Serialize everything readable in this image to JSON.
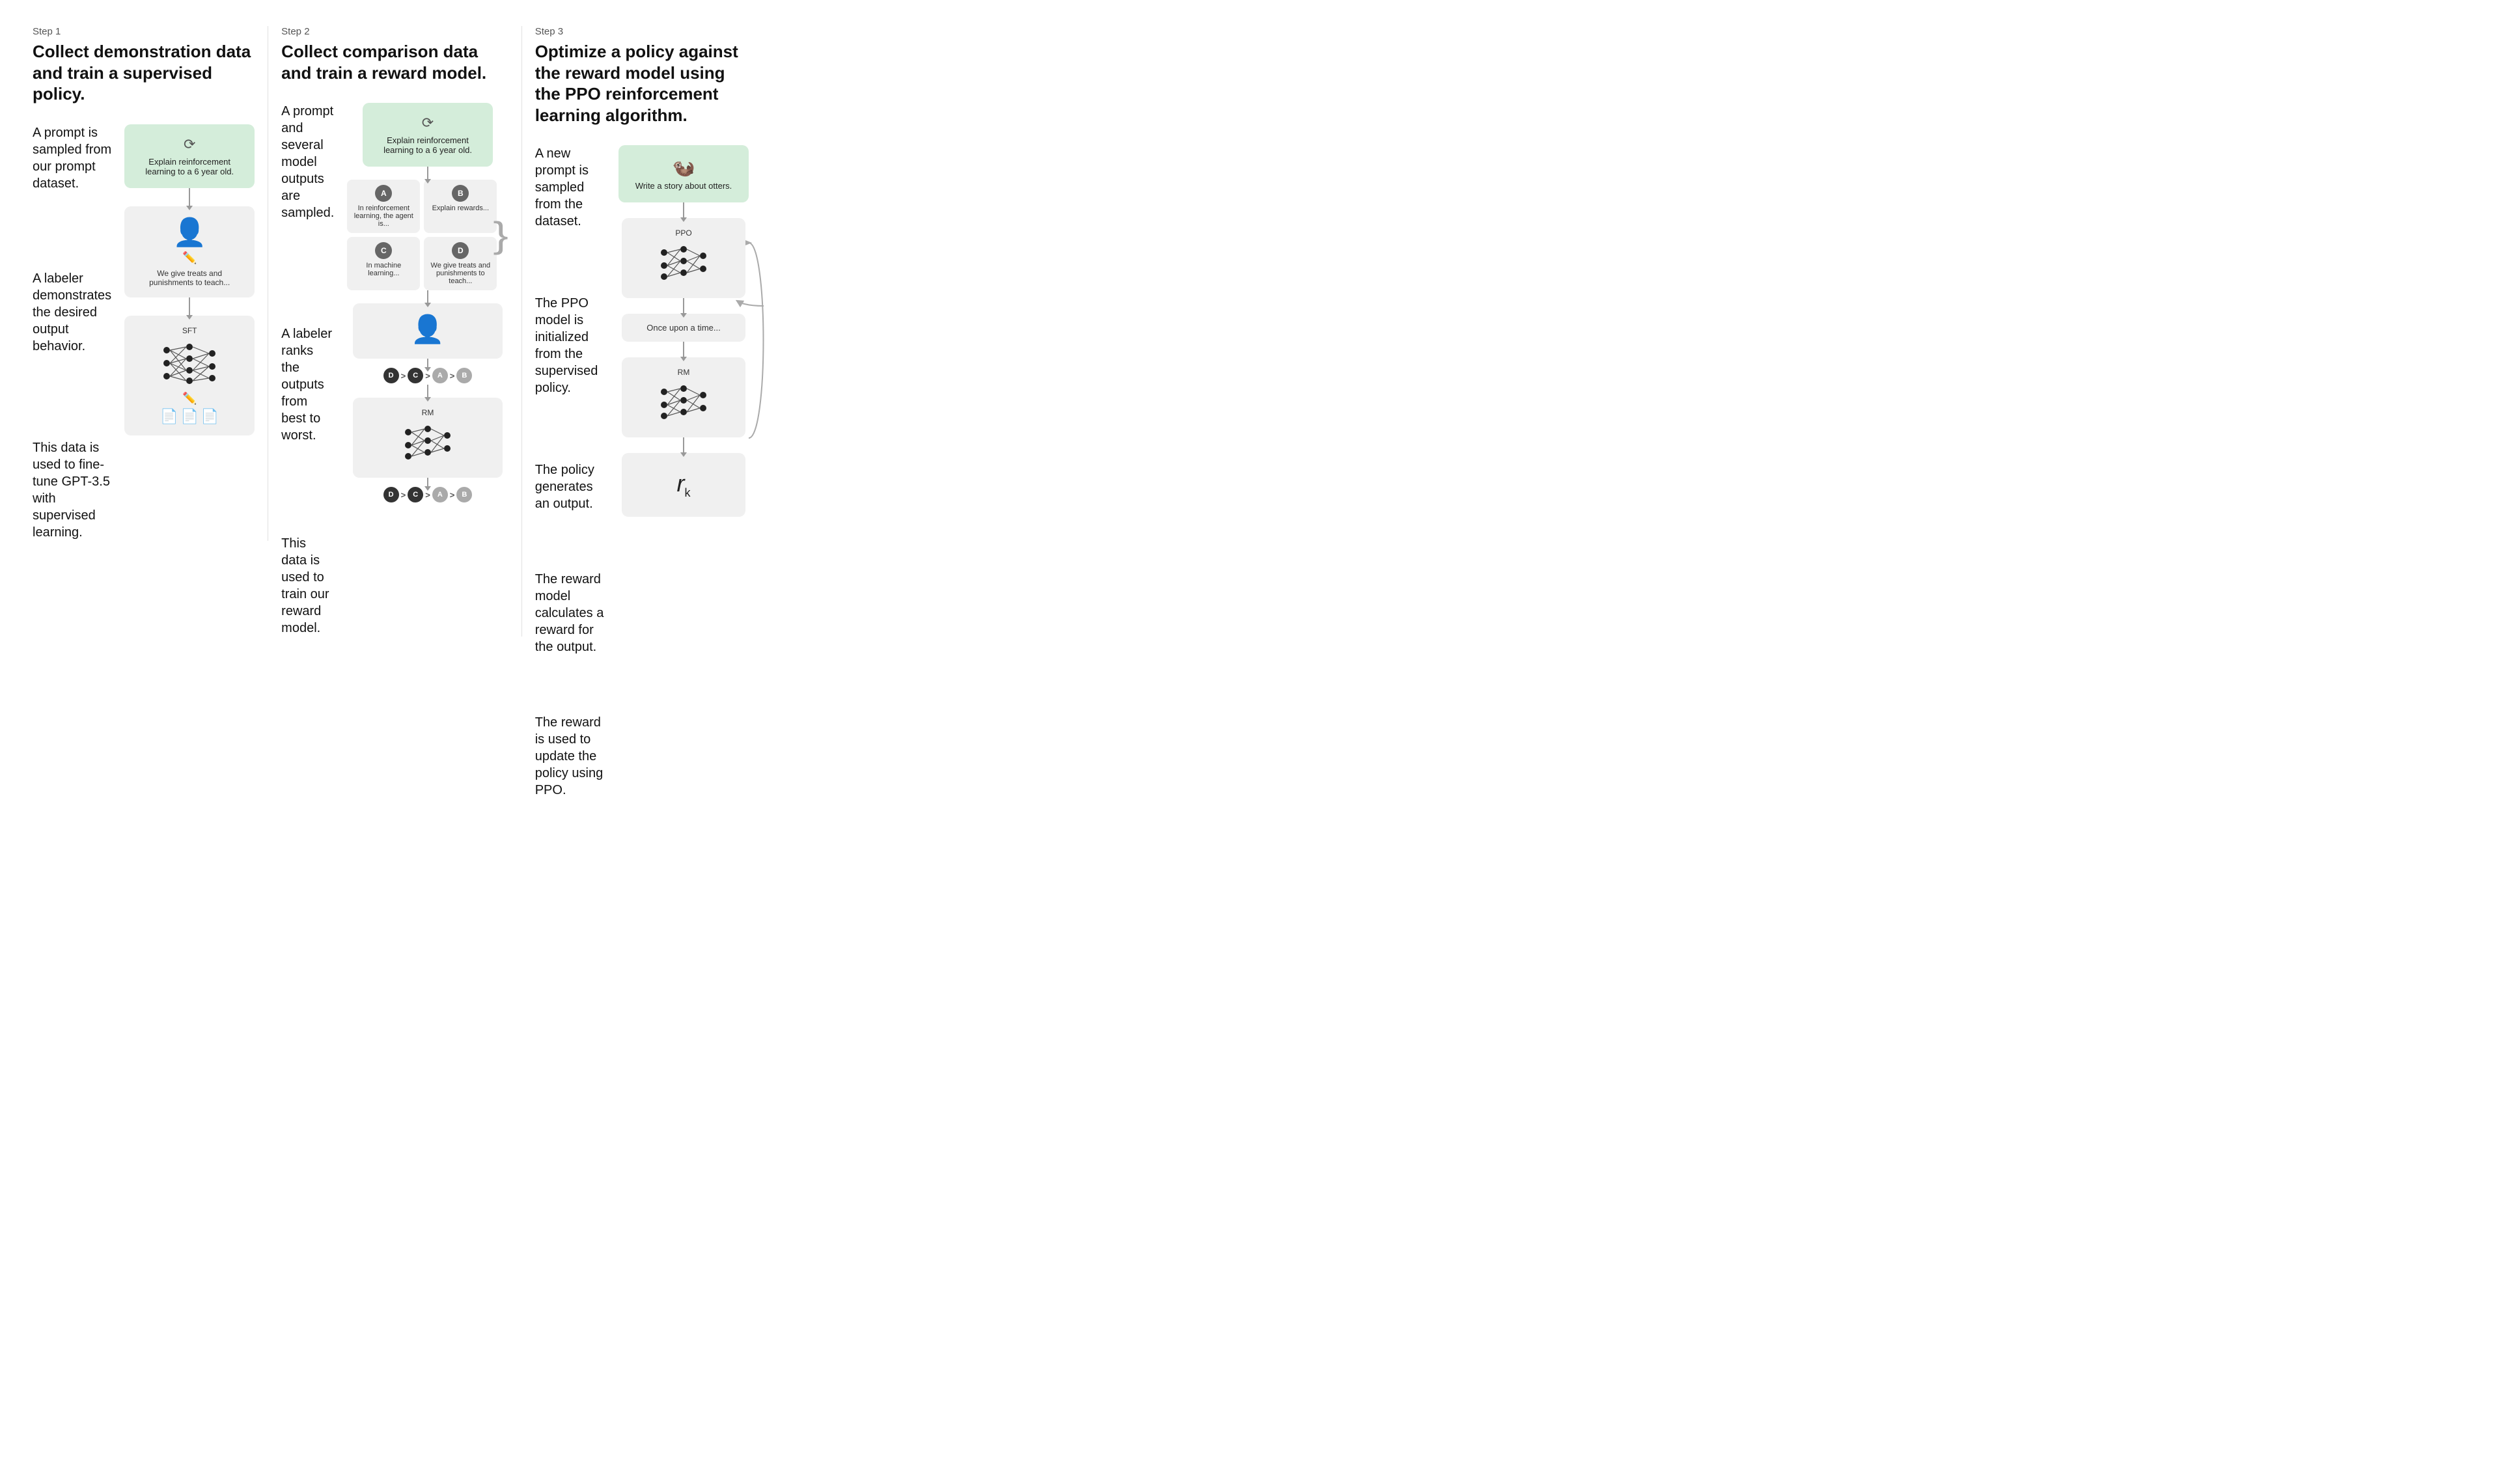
{
  "steps": [
    {
      "id": "step1",
      "label": "Step 1",
      "title": "Collect demonstration data and train a supervised policy.",
      "prompt_icon": "↻",
      "prompt_text": "Explain reinforcement learning to a 6 year old.",
      "sections": [
        {
          "text": "A prompt is sampled from our prompt dataset."
        },
        {
          "text": "A labeler demonstrates the desired output behavior.",
          "card_text": "We give treats and punishments to teach..."
        },
        {
          "text": "This data is used to fine-tune GPT-3.5 with supervised learning.",
          "model_label": "SFT"
        }
      ]
    },
    {
      "id": "step2",
      "label": "Step 2",
      "title": "Collect comparison data and train a reward model.",
      "prompt_icon": "↻",
      "prompt_text": "Explain reinforcement learning to a 6 year old.",
      "sections": [
        {
          "text": "A prompt and several model outputs are sampled."
        },
        {
          "text": "A labeler ranks the outputs from best to worst."
        },
        {
          "text": "This data is used to train our reward model.",
          "model_label": "RM"
        }
      ],
      "options": [
        {
          "label": "A",
          "text": "In reinforcement learning, the agent is..."
        },
        {
          "label": "B",
          "text": "Explain rewards..."
        },
        {
          "label": "C",
          "text": "In machine learning..."
        },
        {
          "label": "D",
          "text": "We give treats and punishments to teach..."
        }
      ],
      "ranking": [
        "D",
        "C",
        "A",
        "B"
      ],
      "ranking_top": [
        "D",
        "C",
        "A",
        "B"
      ]
    },
    {
      "id": "step3",
      "label": "Step 3",
      "title": "Optimize a policy against the reward model using the PPO reinforcement learning algorithm.",
      "prompt_icon": "↻",
      "prompt_text": "Write a story about otters.",
      "sections": [
        {
          "text": "A new prompt is sampled from the dataset."
        },
        {
          "text": "The PPO model is initialized from the supervised policy.",
          "model_label": "PPO"
        },
        {
          "text": "The policy generates an output.",
          "output_text": "Once upon a time..."
        },
        {
          "text": "The reward model calculates a reward for the output.",
          "model_label": "RM"
        },
        {
          "text": "The reward is used to update the policy using PPO.",
          "reward": "r"
        }
      ]
    }
  ],
  "icons": {
    "recycle": "⟳",
    "person": "👤",
    "pencil": "✏",
    "document": "📄",
    "otter": "🦦"
  }
}
